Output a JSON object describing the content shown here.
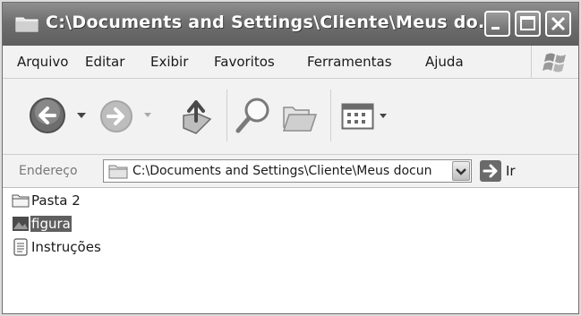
{
  "window": {
    "title": "C:\\Documents and Settings\\Cliente\\Meus do..."
  },
  "menu": {
    "items": [
      {
        "label": "Arquivo"
      },
      {
        "label": "Editar"
      },
      {
        "label": "Exibir"
      },
      {
        "label": "Favoritos"
      },
      {
        "label": "Ferramentas"
      },
      {
        "label": "Ajuda"
      }
    ]
  },
  "toolbar": {
    "icons": [
      "back-arrow-icon",
      "forward-arrow-icon",
      "up-folder-icon",
      "search-icon",
      "folders-icon",
      "views-icon"
    ]
  },
  "address": {
    "label": "Endereço",
    "value": "C:\\Documents and Settings\\Cliente\\Meus docun",
    "go_label": "Ir"
  },
  "files": [
    {
      "name": "Pasta 2",
      "icon": "folder-icon",
      "selected": false
    },
    {
      "name": "figura",
      "icon": "image-file-icon",
      "selected": true
    },
    {
      "name": "Instruções",
      "icon": "text-file-icon",
      "selected": false
    }
  ]
}
